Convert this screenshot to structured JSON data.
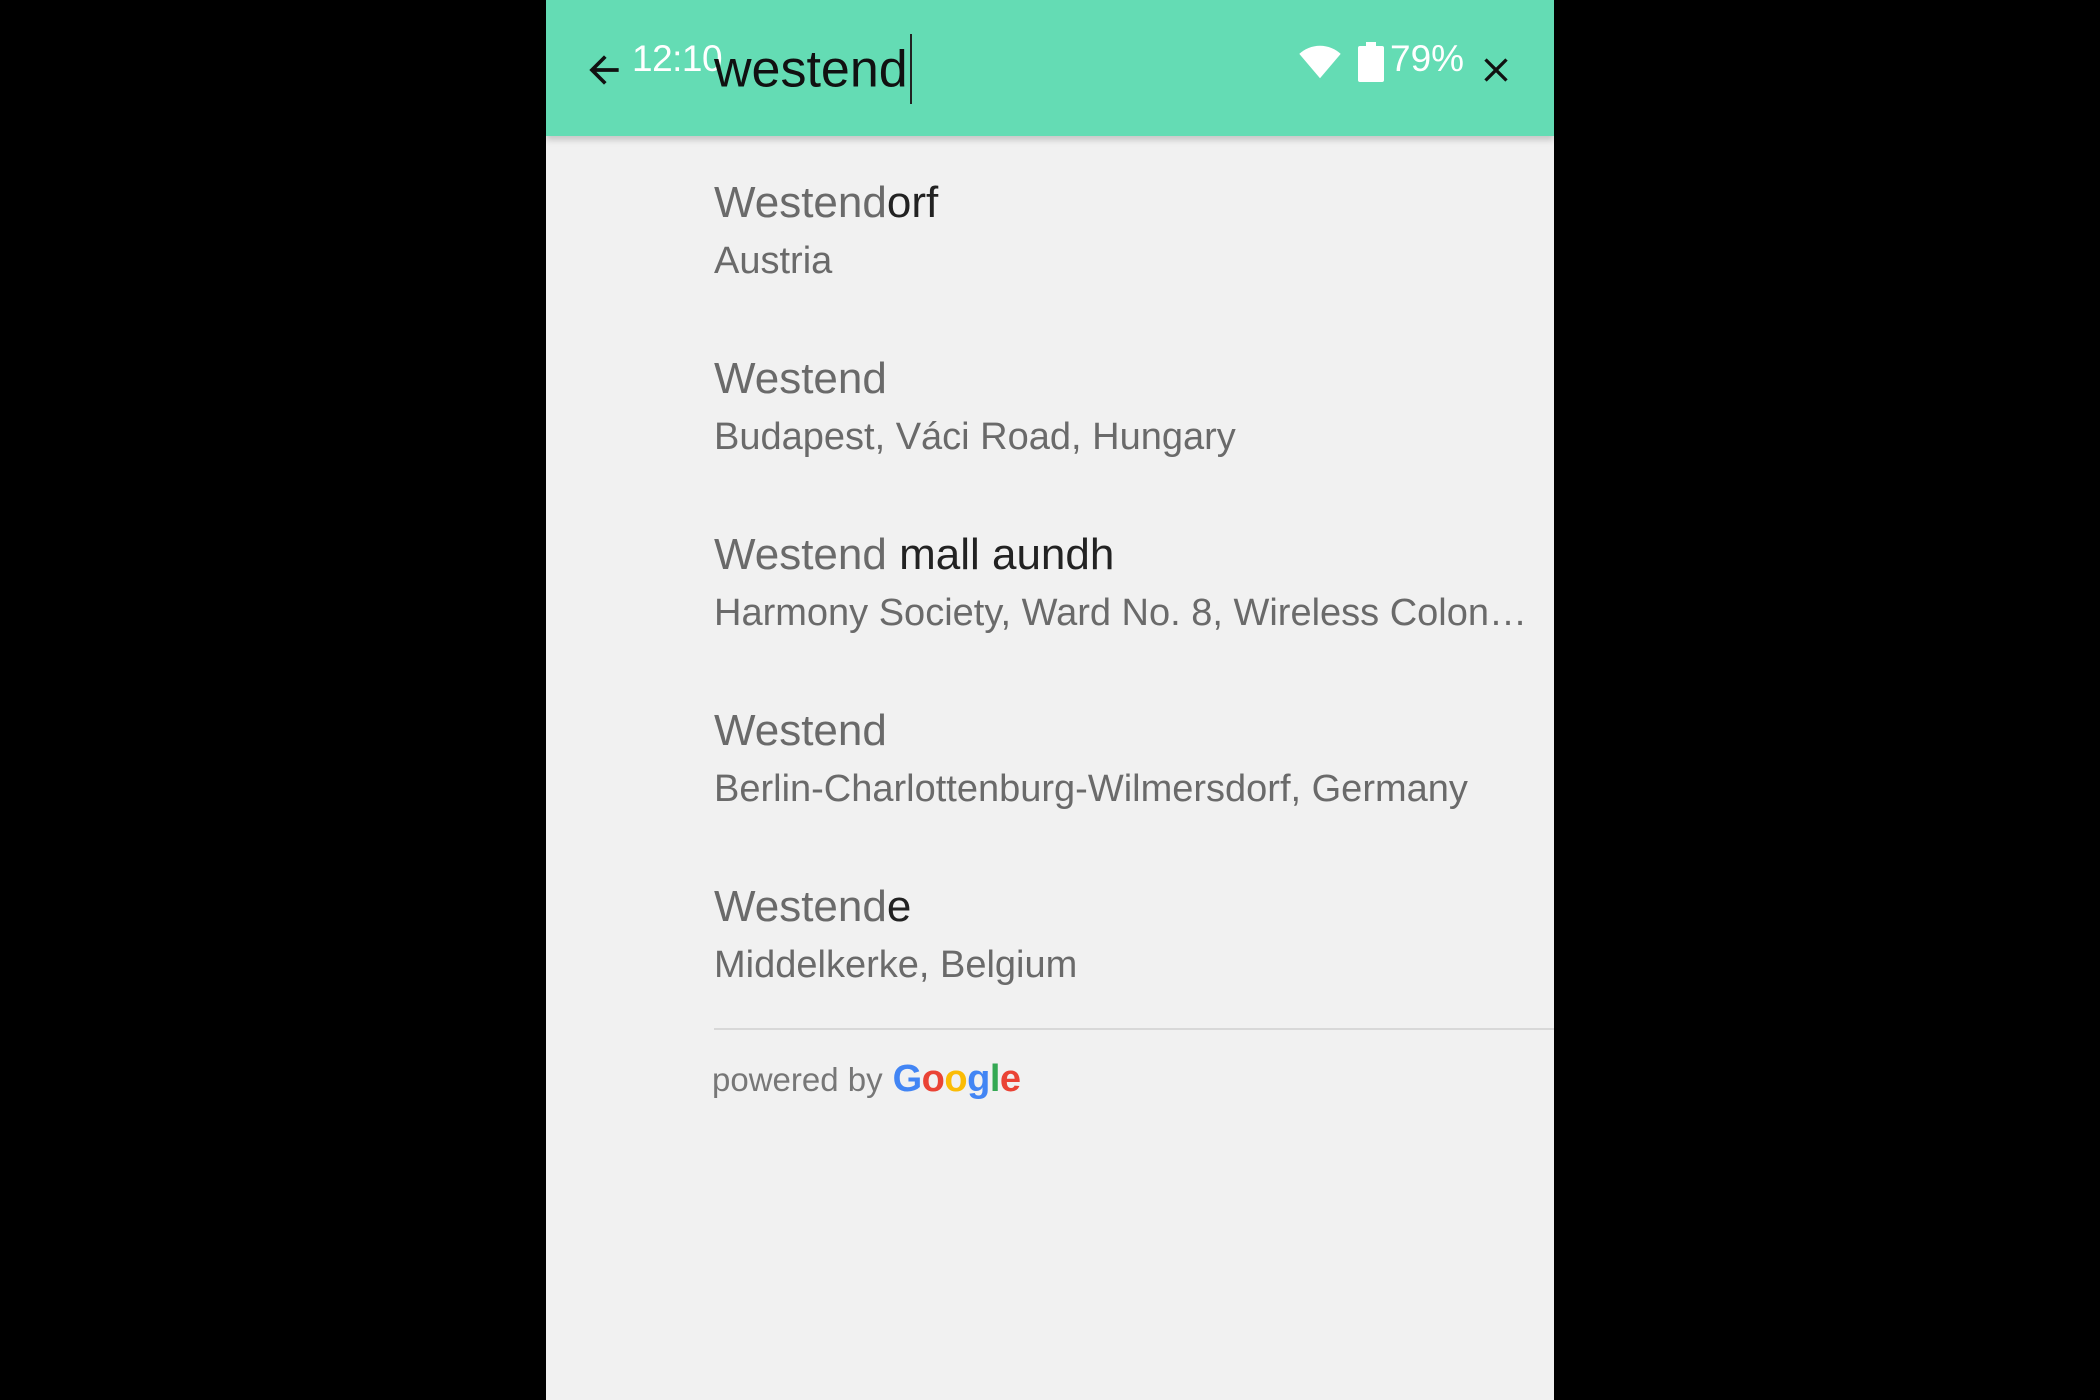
{
  "status_bar": {
    "time": "12:10",
    "battery_percent": "79%"
  },
  "search": {
    "value": "westend"
  },
  "icons": {
    "back": "arrow-back-icon",
    "wifi": "wifi-icon",
    "battery": "battery-icon",
    "close": "close-icon"
  },
  "colors": {
    "toolbar": "#64dcb4",
    "background": "#f1f1f1",
    "matched_text": "#6a6a6a",
    "unmatched_text": "#222222"
  },
  "results": [
    {
      "matched": "Westend",
      "rest": "orf",
      "address": "Austria"
    },
    {
      "matched": "Westend",
      "rest": "",
      "address": "Budapest, Váci Road, Hungary"
    },
    {
      "matched": "Westend",
      "rest": " mall aundh",
      "address": "Harmony Society, Ward No. 8, Wireless Colon…"
    },
    {
      "matched": "Westend",
      "rest": "",
      "address": "Berlin-Charlottenburg-Wilmersdorf, Germany"
    },
    {
      "matched": "Westend",
      "rest": "e",
      "address": "Middelkerke, Belgium"
    }
  ],
  "attribution": {
    "prefix": "powered by",
    "brand": [
      "G",
      "o",
      "o",
      "g",
      "l",
      "e"
    ],
    "brand_colors": [
      "#4285F4",
      "#EA4335",
      "#FBBC05",
      "#4285F4",
      "#34A853",
      "#EA4335"
    ]
  }
}
